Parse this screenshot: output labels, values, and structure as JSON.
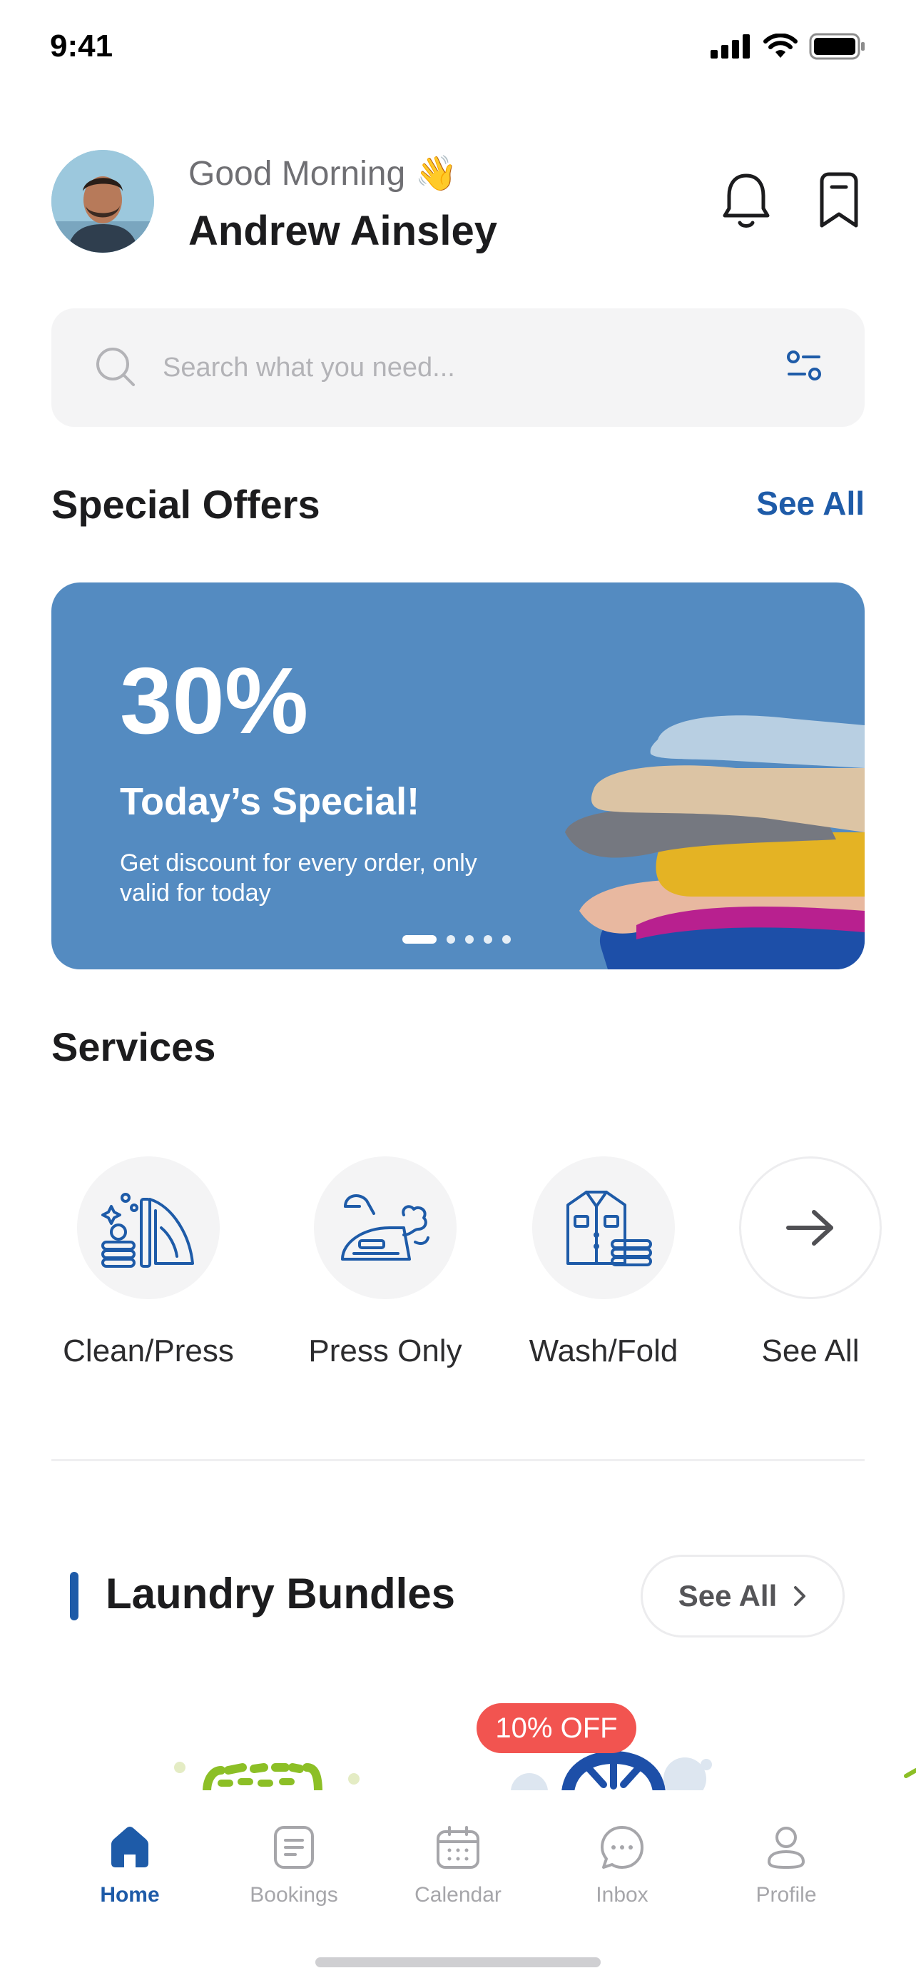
{
  "status_bar": {
    "time": "9:41"
  },
  "header": {
    "greeting": "Good Morning 👋",
    "user_name": "Andrew Ainsley"
  },
  "search": {
    "placeholder": "Search what you need...",
    "value": ""
  },
  "special_offers": {
    "title": "Special Offers",
    "see_all": "See All",
    "card": {
      "percent": "30%",
      "title": "Today’s Special!",
      "description": "Get discount for every order, only valid for today",
      "background": "#548bc1",
      "slide_count": 5,
      "active_slide": 1
    }
  },
  "services": {
    "title": "Services",
    "items": [
      {
        "label": "Clean/Press",
        "icon": "clean-press-icon"
      },
      {
        "label": "Press Only",
        "icon": "iron-icon"
      },
      {
        "label": "Wash/Fold",
        "icon": "wash-fold-icon"
      },
      {
        "label": "See All",
        "icon": "arrow-right-icon"
      }
    ]
  },
  "bundles": {
    "title": "Laundry Bundles",
    "see_all": "See All",
    "badge": "10% OFF"
  },
  "bottom_nav": {
    "items": [
      {
        "label": "Home",
        "icon": "home-icon",
        "active": true
      },
      {
        "label": "Bookings",
        "icon": "bookings-icon",
        "active": false
      },
      {
        "label": "Calendar",
        "icon": "calendar-icon",
        "active": false
      },
      {
        "label": "Inbox",
        "icon": "inbox-icon",
        "active": false
      },
      {
        "label": "Profile",
        "icon": "profile-icon",
        "active": false
      }
    ]
  },
  "colors": {
    "accent": "#1e5ba8",
    "offer_card": "#548bc1",
    "badge": "#f25450"
  }
}
